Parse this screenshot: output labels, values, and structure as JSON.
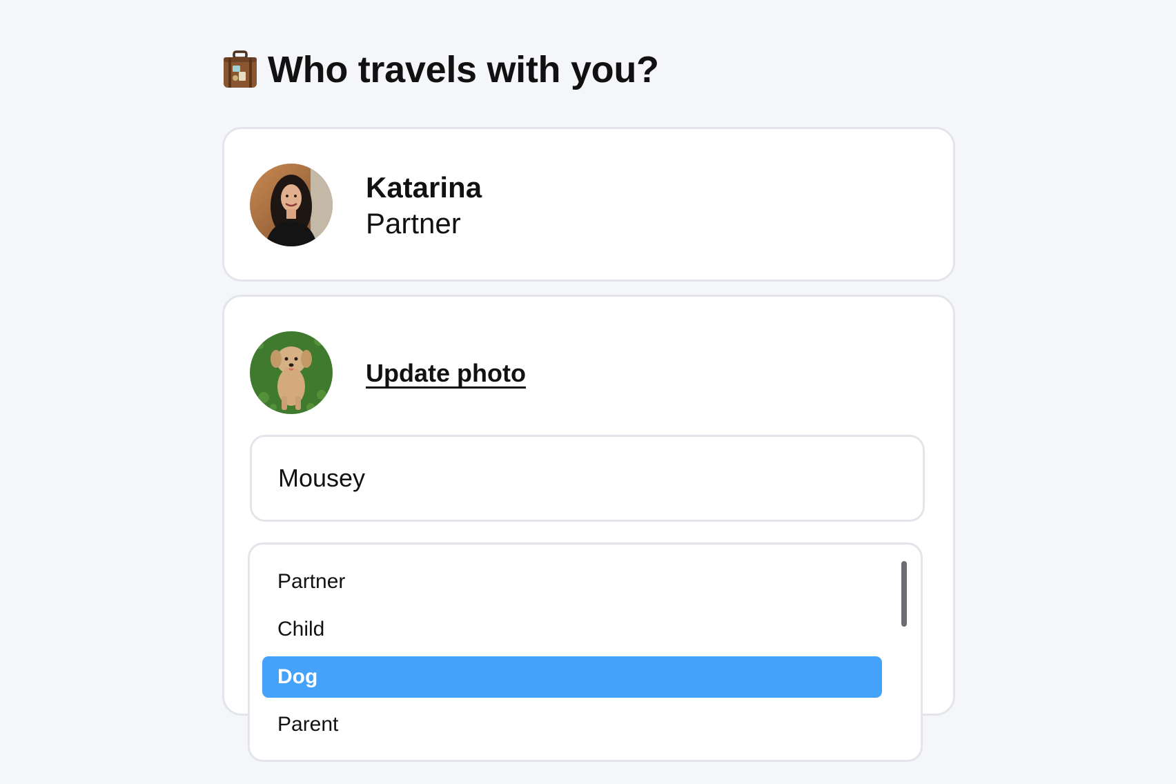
{
  "header": {
    "icon": "suitcase-icon",
    "title": "Who travels with you?"
  },
  "travelers": [
    {
      "name": "Katarina",
      "relation": "Partner",
      "avatar": "woman-portrait-avatar"
    }
  ],
  "edit_traveler": {
    "avatar": "dog-photo-avatar",
    "update_photo_label": "Update photo",
    "name_value": "Mousey",
    "relation_options": [
      "Partner",
      "Child",
      "Dog",
      "Parent"
    ],
    "selected_relation": "Dog"
  },
  "colors": {
    "background": "#f4f6f9",
    "card": "#ffffff",
    "border": "#e3e5ea",
    "selected": "#44a2fb"
  }
}
